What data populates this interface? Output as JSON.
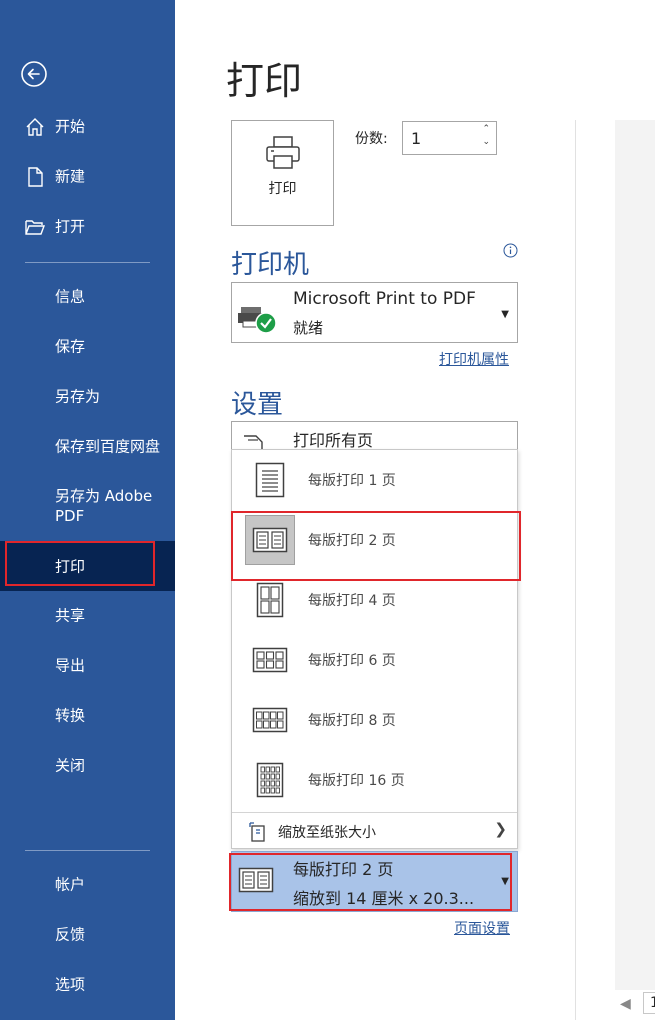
{
  "sidebar": {
    "back_label": "",
    "items": [
      {
        "label": "开始"
      },
      {
        "label": "新建"
      },
      {
        "label": "打开"
      },
      {
        "label": "信息"
      },
      {
        "label": "保存"
      },
      {
        "label": "另存为"
      },
      {
        "label": "保存到百度网盘"
      },
      {
        "label": "另存为 Adobe PDF"
      },
      {
        "label": "打印"
      },
      {
        "label": "共享"
      },
      {
        "label": "导出"
      },
      {
        "label": "转换"
      },
      {
        "label": "关闭"
      },
      {
        "label": "帐户"
      },
      {
        "label": "反馈"
      },
      {
        "label": "选项"
      }
    ],
    "active": "打印"
  },
  "main": {
    "title": "打印",
    "print_button_label": "打印",
    "copies_label": "份数:",
    "copies_value": "1"
  },
  "printer": {
    "heading": "打印机",
    "name": "Microsoft Print to PDF",
    "status": "就绪",
    "properties_link": "打印机属性"
  },
  "settings": {
    "heading": "设置",
    "print_range": "打印所有页",
    "pages_per_sheet_menu": [
      {
        "label": "每版打印 1 页",
        "icon": "one-page-icon"
      },
      {
        "label": "每版打印 2 页",
        "icon": "two-pages-icon",
        "selected": true
      },
      {
        "label": "每版打印 4 页",
        "icon": "four-pages-icon"
      },
      {
        "label": "每版打印 6 页",
        "icon": "six-pages-icon"
      },
      {
        "label": "每版打印 8 页",
        "icon": "eight-pages-icon"
      },
      {
        "label": "每版打印 16 页",
        "icon": "sixteen-pages-icon"
      }
    ],
    "scale_to_paper": "缩放至纸张大小",
    "current_selection": {
      "line1": "每版打印 2 页",
      "line2": "缩放到 14 厘米 x 20.3..."
    },
    "page_setup_link": "页面设置"
  },
  "preview": {
    "page_number": "1"
  },
  "colors": {
    "sidebar_bg": "#2b579a",
    "sidebar_active": "#072452",
    "accent": "#2b579a",
    "highlight_box": "#e0262b",
    "selected_dropdown_bg": "#a9c3e8"
  }
}
